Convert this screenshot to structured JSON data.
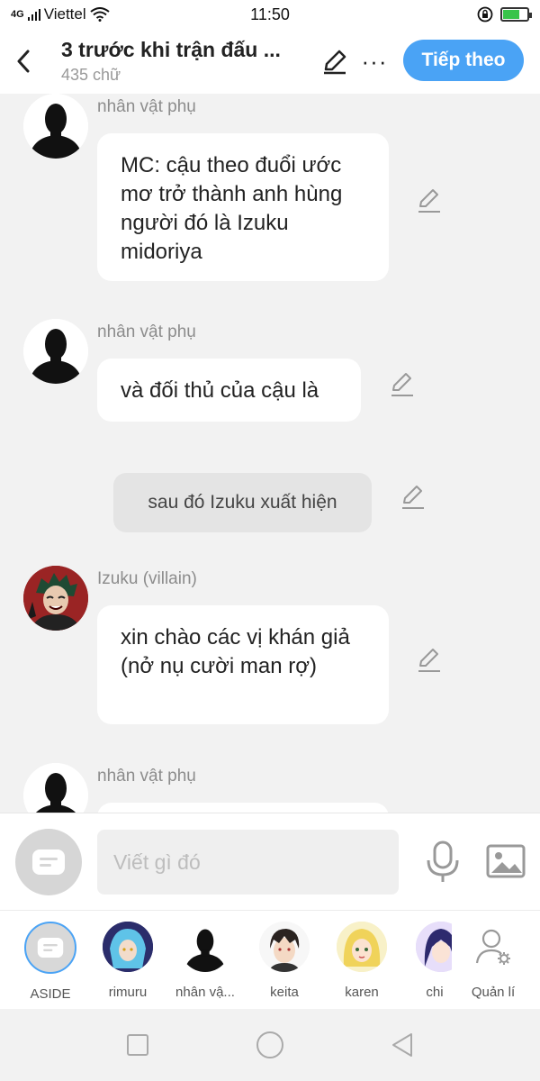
{
  "status_bar": {
    "network": "4G",
    "carrier": "Viettel",
    "time": "11:50",
    "battery_level": 0.7
  },
  "header": {
    "title": "3 trước khi trận đấu ...",
    "subtitle": "435 chữ",
    "next_label": "Tiếp theo",
    "more_label": "···"
  },
  "messages": [
    {
      "type": "character",
      "sender": "nhân vật phụ",
      "avatar": "silhouette-avatar",
      "text": "MC: cậu theo đuổi ước mơ trở thành anh hùng người đó là Izuku midoriya"
    },
    {
      "type": "character",
      "sender": "nhân vật phụ",
      "avatar": "silhouette-avatar",
      "text": "và đối thủ của cậu là"
    },
    {
      "type": "aside",
      "text": "sau đó Izuku xuất hiện"
    },
    {
      "type": "character",
      "sender": "Izuku (villain)",
      "avatar": "izuku-avatar",
      "text": "xin chào các vị khán giả (nở nụ cười man rợ)"
    },
    {
      "type": "character",
      "sender": "nhân vật phụ",
      "avatar": "silhouette-avatar",
      "text": ""
    }
  ],
  "input": {
    "placeholder": "Viết gì đó"
  },
  "characters": [
    {
      "label": "ASIDE"
    },
    {
      "label": "rimuru"
    },
    {
      "label": "nhân vậ..."
    },
    {
      "label": "keita"
    },
    {
      "label": "karen"
    },
    {
      "label": "chi"
    },
    {
      "label": "Quản lí"
    }
  ],
  "colors": {
    "accent": "#4aa3f5",
    "background": "#f2f2f2",
    "bubble": "#ffffff",
    "aside_bubble": "#e4e4e4"
  }
}
